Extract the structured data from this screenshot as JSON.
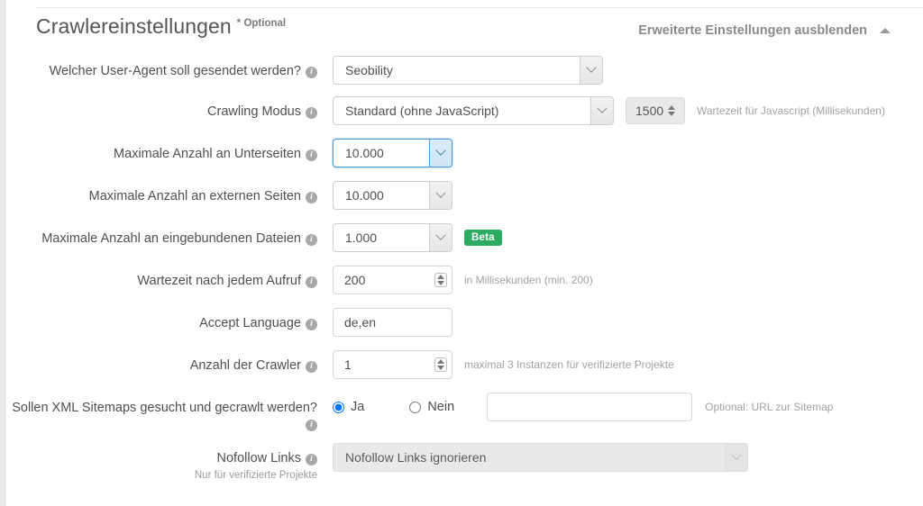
{
  "header": {
    "title": "Crawlereinstellungen",
    "optional_flag": "* Optional",
    "toggle_advanced_label": "Erweiterte Einstellungen ausblenden",
    "toggle_icon": "caret-up-icon"
  },
  "info_icon_glyph": "i",
  "rows": {
    "user_agent": {
      "label": "Welcher User-Agent soll gesendet werden?",
      "value": "Seobility"
    },
    "crawling_mode": {
      "label": "Crawling Modus",
      "value": "Standard (ohne JavaScript)",
      "js_wait_value": "1500",
      "js_wait_hint": "Wartezeit für Javascript (Millisekunden)"
    },
    "max_subpages": {
      "label": "Maximale Anzahl an Unterseiten",
      "value": "10.000"
    },
    "max_external": {
      "label": "Maximale Anzahl an externen Seiten",
      "value": "10.000"
    },
    "max_embedded": {
      "label": "Maximale Anzahl an eingebundenen Dateien",
      "value": "1.000",
      "badge": "Beta"
    },
    "wait_per_call": {
      "label": "Wartezeit nach jedem Aufruf",
      "value": "200",
      "hint": "in Millisekunden (min. 200)"
    },
    "accept_language": {
      "label": "Accept Language",
      "value": "de,en"
    },
    "crawler_count": {
      "label": "Anzahl der Crawler",
      "value": "1",
      "hint": "maximal 3 Instanzen für verifizierte Projekte"
    },
    "xml_sitemaps": {
      "label": "Sollen XML Sitemaps gesucht und gecrawlt werden?",
      "option_yes": "Ja",
      "option_no": "Nein",
      "selected": "Ja",
      "sitemap_url_value": "",
      "hint": "Optional: URL zur Sitemap"
    },
    "nofollow_links": {
      "label": "Nofollow Links",
      "sub_label": "Nur für verifizierte Projekte",
      "value": "Nofollow Links ignorieren"
    }
  },
  "colors": {
    "focus_blue": "#4a9ade",
    "badge_green": "#2eab63",
    "text": "#4f4f4f",
    "hint": "#a2a2a2"
  }
}
